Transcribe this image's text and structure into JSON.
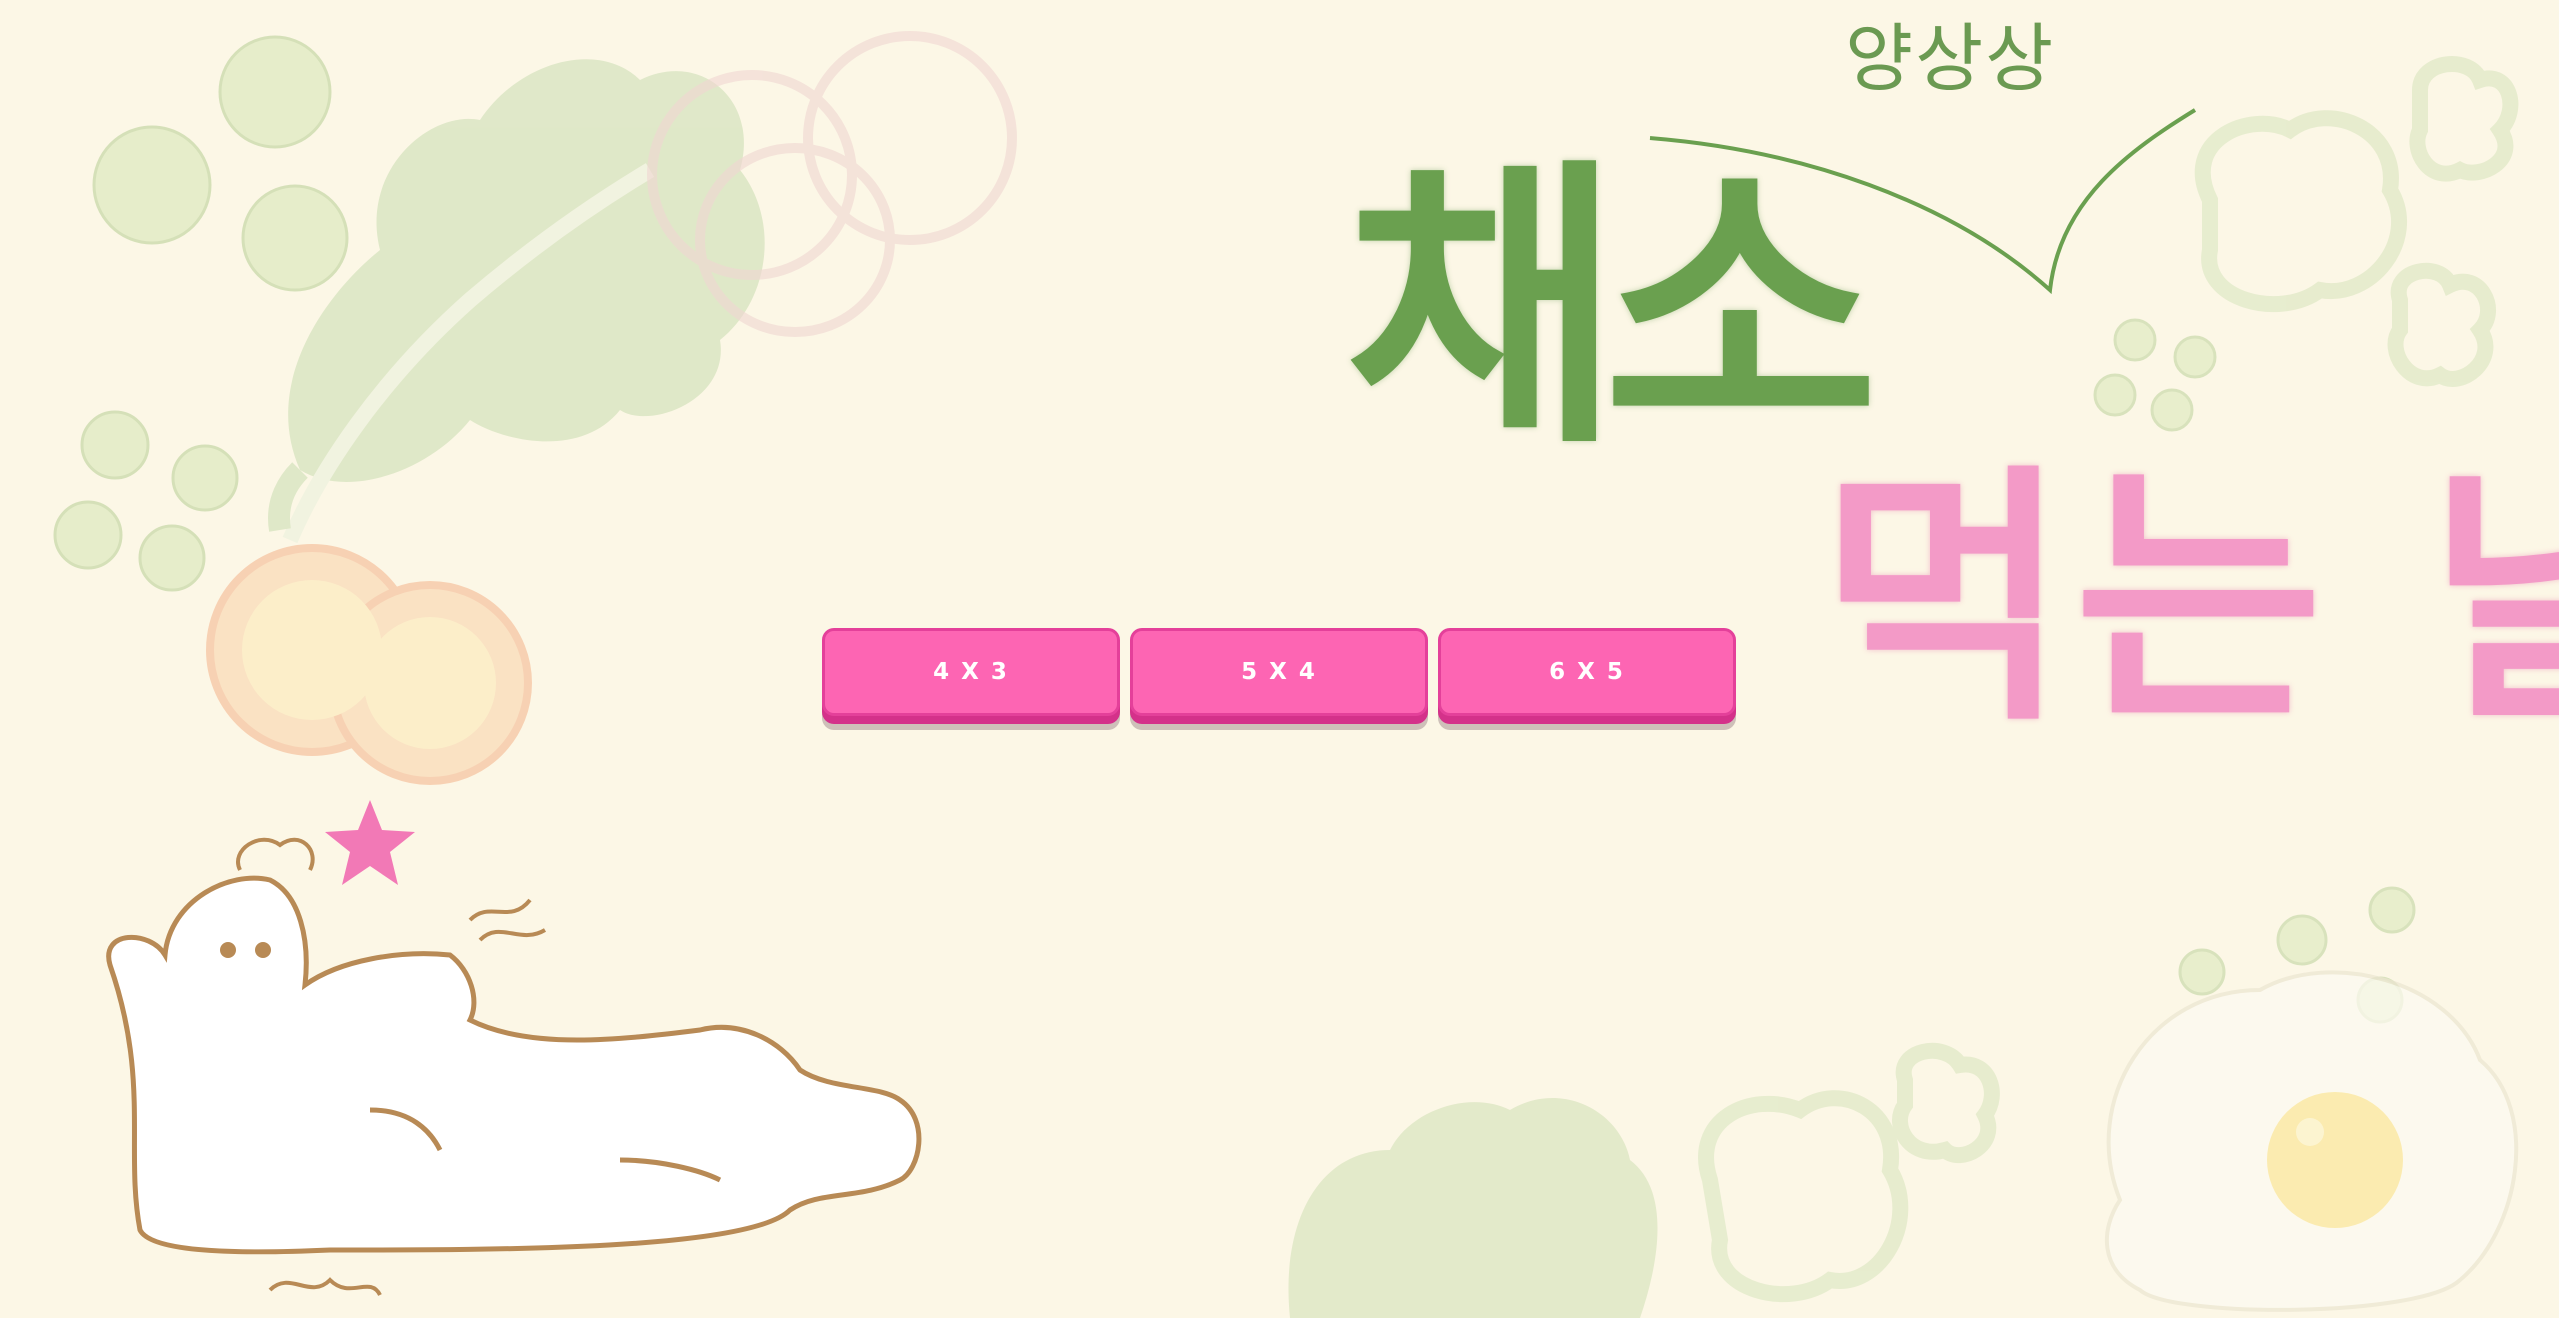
{
  "title": {
    "small": "양상상",
    "green": "채소",
    "pink": "먹는 날"
  },
  "size_options": [
    {
      "label": "4 X 3"
    },
    {
      "label": "5 X 4"
    },
    {
      "label": "6 X 5"
    }
  ],
  "colors": {
    "background": "#fcf7e6",
    "button": "#fd65b3",
    "button_border": "#e4409a",
    "title_green": "#6aa04f",
    "title_pink": "#f39ac7"
  }
}
